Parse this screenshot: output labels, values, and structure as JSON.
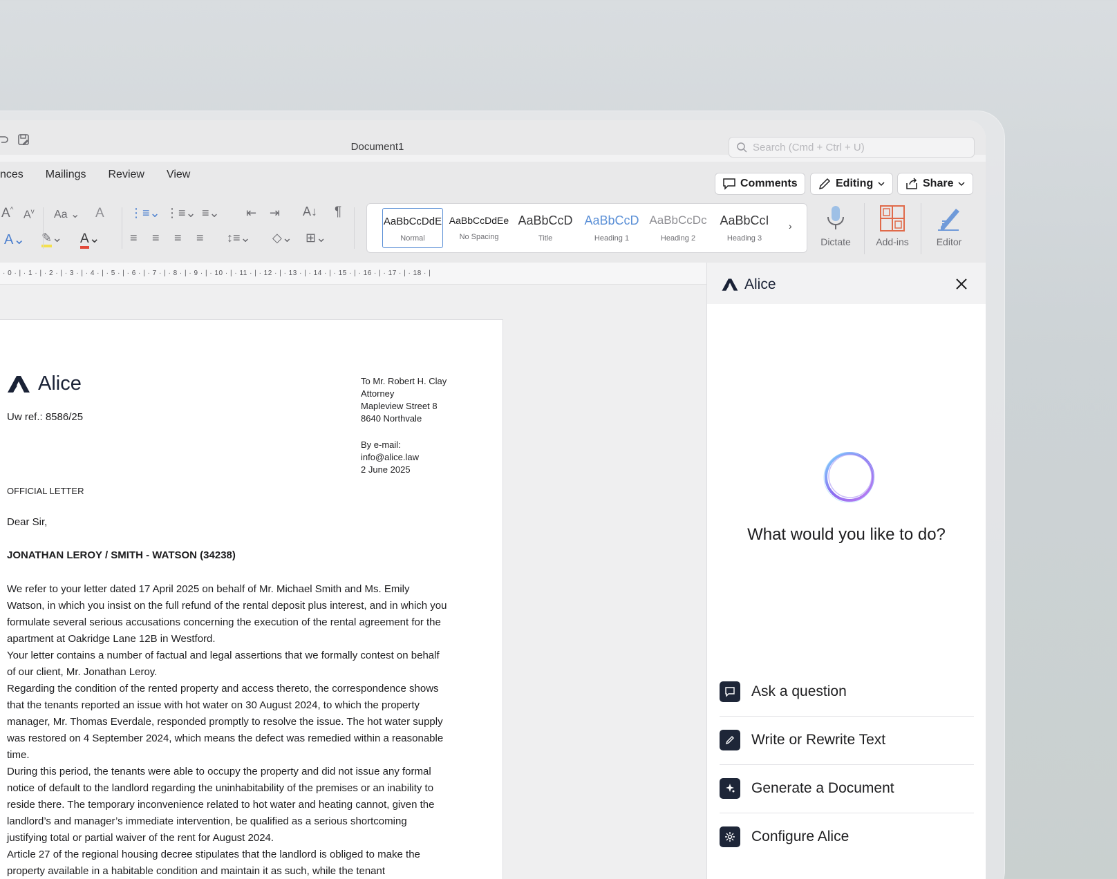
{
  "window": {
    "title": "Document1",
    "search_placeholder": "Search (Cmd + Ctrl + U)"
  },
  "menu": {
    "tabs": [
      "nces",
      "Mailings",
      "Review",
      "View"
    ],
    "comments_label": "Comments",
    "editing_label": "Editing",
    "share_label": "Share"
  },
  "ribbon": {
    "font_size_label": "Aa",
    "styles": [
      {
        "sample": "AaBbCcDdE",
        "name": "Normal"
      },
      {
        "sample": "AaBbCcDdEe",
        "name": "No Spacing"
      },
      {
        "sample": "AaBbCcD",
        "name": "Title"
      },
      {
        "sample": "AaBbCcD",
        "name": "Heading 1"
      },
      {
        "sample": "AaBbCcDc",
        "name": "Heading 2"
      },
      {
        "sample": "AaBbCcI",
        "name": "Heading 3"
      }
    ],
    "dictate_label": "Dictate",
    "addins_label": "Add-ins",
    "editor_label": "Editor"
  },
  "ruler": {
    "text": "· 0 · | · 1 · | · 2 · | · 3 · | · 4 · | · 5 · | · 6 · | · 7 · | · 8 · | · 9 · | · 10 · | · 11 · | · 12 · | · 13 · | · 14 · | · 15 · | · 16 · | · 17 · | · 18 · |"
  },
  "letter": {
    "logo_text": "Alice",
    "reference": "Uw ref.: 8586/25",
    "recipient_lines": [
      "To Mr. Robert H. Clay",
      "Attorney",
      "Mapleview Street 8",
      "8640 Northvale"
    ],
    "delivery_lines": [
      "By e-mail:",
      "info@alice.law",
      "2 June 2025"
    ],
    "type": "OFFICIAL LETTER",
    "salutation": "Dear Sir,",
    "subject": "JONATHAN LEROY / SMITH - WATSON (34238)",
    "paragraphs": [
      "We refer to your letter dated 17 April 2025 on behalf of Mr. Michael Smith and Ms. Emily Watson, in which you insist on the full refund of the rental deposit plus interest, and in which you formulate several serious accusations concerning the execution of the rental agreement for the apartment at Oakridge Lane 12B in Westford.",
      "Your letter contains a number of factual and legal assertions that we formally contest on behalf of our client, Mr. Jonathan Leroy.",
      "Regarding the condition of the rented property and access thereto, the correspondence shows that the tenants reported an issue with hot water on 30 August 2024, to which the property manager, Mr. Thomas Everdale, responded promptly to resolve the issue. The hot water supply was restored on 4 September 2024, which means the defect was remedied within a reasonable time.",
      "During this period, the tenants were able to occupy the property and did not issue any formal notice of default to the landlord regarding the uninhabitability of the premises or an inability to reside there. The temporary inconvenience related to hot water and heating cannot, given the landlord’s and manager’s immediate intervention, be qualified as a serious shortcoming justifying total or partial waiver of the rent for August 2024.",
      "Article 27 of the regional housing decree stipulates that the landlord is obliged to make the property available in a habitable condition and maintain it as such, while the tenant"
    ]
  },
  "assistant": {
    "name": "Alice",
    "prompt": "What would you like to do?",
    "actions": [
      {
        "label": "Ask a question",
        "icon": "chat-icon"
      },
      {
        "label": "Write or Rewrite Text",
        "icon": "pencil-icon"
      },
      {
        "label": "Generate a Document",
        "icon": "sparkle-icon"
      },
      {
        "label": "Configure Alice",
        "icon": "gear-icon"
      }
    ]
  },
  "colors": {
    "brand_navy": "#1a2236",
    "accent_blue": "#5a8fd6",
    "addins_orange": "#e06a4a"
  }
}
